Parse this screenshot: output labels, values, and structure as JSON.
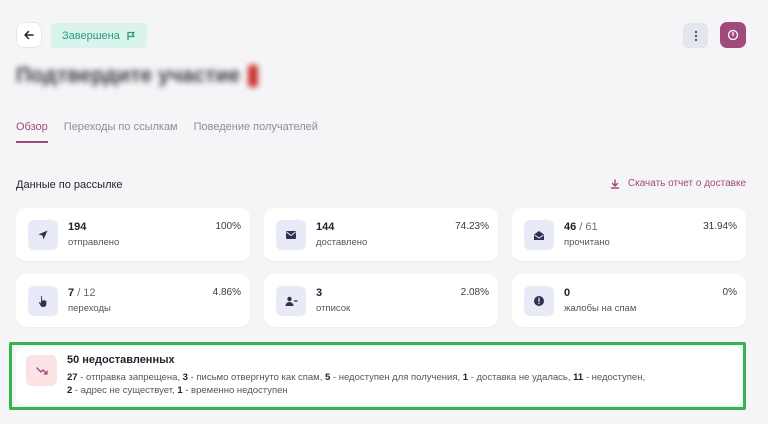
{
  "header": {
    "status": "Завершена",
    "title": "Подтвердите участие"
  },
  "tabs": [
    {
      "label": "Обзор",
      "active": true
    },
    {
      "label": "Переходы по ссылкам",
      "active": false
    },
    {
      "label": "Поведение получателей",
      "active": false
    }
  ],
  "section": {
    "title": "Данные по рассылке",
    "download_label": "Скачать отчет о доставке"
  },
  "stats": [
    {
      "icon": "send-icon",
      "value": "194",
      "total": "",
      "label": "отправлено",
      "percent": "100%"
    },
    {
      "icon": "mail-icon",
      "value": "144",
      "total": "",
      "label": "доставлено",
      "percent": "74.23%"
    },
    {
      "icon": "open-mail-icon",
      "value": "46",
      "total": "/ 61",
      "label": "прочитано",
      "percent": "31.94%"
    },
    {
      "icon": "pointer-hand-icon",
      "value": "7",
      "total": "/ 12",
      "label": "переходы",
      "percent": "4.86%"
    },
    {
      "icon": "user-minus-icon",
      "value": "3",
      "total": "",
      "label": "отписок",
      "percent": "2.08%"
    },
    {
      "icon": "alert-icon",
      "value": "0",
      "total": "",
      "label": "жалобы на спам",
      "percent": "0%"
    }
  ],
  "undelivered": {
    "title": "50 недоставленных",
    "items": [
      {
        "count": "27",
        "text": " - отправка запрещена, "
      },
      {
        "count": "3",
        "text": " - письмо отвергнуто как спам, "
      },
      {
        "count": "5",
        "text": " - недоступен для получения, "
      },
      {
        "count": "1",
        "text": " - доставка не удалась, "
      },
      {
        "count": "11",
        "text": " - недоступен, "
      },
      {
        "count": "2",
        "text": " - адрес не существует, "
      },
      {
        "count": "1",
        "text": " - временно недоступен"
      }
    ]
  },
  "colors": {
    "accent": "#a1497b",
    "status_bg": "#d8f4ec",
    "status_text": "#2f9a7b",
    "highlight": "#36b34d"
  }
}
